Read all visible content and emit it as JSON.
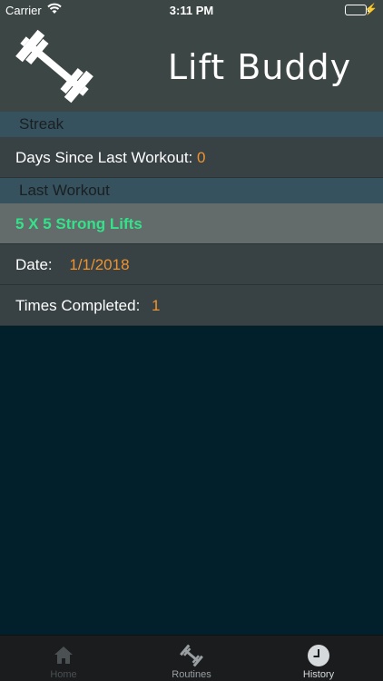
{
  "status_bar": {
    "carrier": "Carrier",
    "time": "3:11 PM"
  },
  "header": {
    "title": "Lift Buddy",
    "logo_icon": "barbell-icon"
  },
  "streak": {
    "section_title": "Streak",
    "days_label": "Days Since Last Workout:",
    "days_value": "0"
  },
  "last_workout": {
    "section_title": "Last Workout",
    "name": "5 X 5 Strong Lifts",
    "date_label": "Date:",
    "date_value": "1/1/2018",
    "times_label": "Times Completed:",
    "times_value": "1"
  },
  "tabs": [
    {
      "label": "Home",
      "icon": "house-icon",
      "state": "disabled"
    },
    {
      "label": "Routines",
      "icon": "dumbbell-icon",
      "state": "normal"
    },
    {
      "label": "History",
      "icon": "clock-icon",
      "state": "selected"
    }
  ],
  "colors": {
    "header_bg": "#3c4645",
    "section_bg": "#36525e",
    "row_bg": "#384143",
    "highlight_row_bg": "#636b6b",
    "value_orange": "#f0932f",
    "workout_green": "#33e38a",
    "page_bg": "#01202c"
  }
}
